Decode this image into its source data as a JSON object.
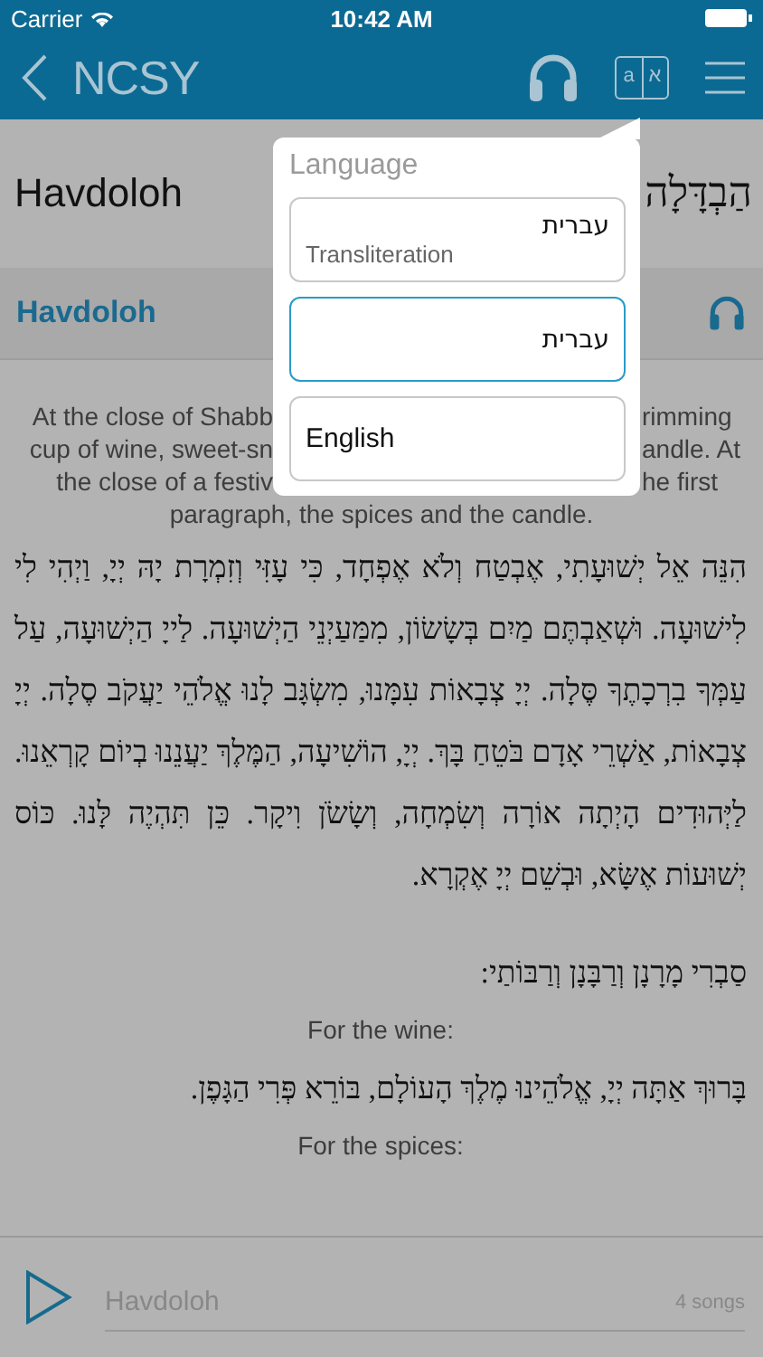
{
  "status_bar": {
    "carrier": "Carrier",
    "time": "10:42 AM"
  },
  "nav": {
    "back_title": "NCSY",
    "language_icon": {
      "latin": "a",
      "hebrew": "א"
    }
  },
  "page_title": {
    "english": "Havdoloh",
    "hebrew": "הַבְדָּלָה"
  },
  "section": {
    "title": "Havdoloh"
  },
  "description_lines": [
    {
      "left": "At the close of Shabb",
      "right": "rimming"
    },
    {
      "left": "cup of wine, sweet-sn",
      "right": "andle. At"
    },
    {
      "left": "the close of a festiv",
      "right": "he first"
    },
    {
      "left": "paragraph, the spices and the candle."
    }
  ],
  "blocks": [
    {
      "kind": "hebrew_paragraph",
      "text": "הִנֵּה אֵל יְשׁוּעָתִי, אֶבְטַח וְלֹא אֶפְחָד, כִּי עָזִּי וְזִמְרָת יָהּ יְיָ, וַיְהִי לִי לִישׁוּעָה. וּשְׁאַבְתֶּם מַיִם בְּשָׂשׂוֹן, מִמַּעַיְנֵי הַיְשׁוּעָה. לַייָ הַיְשׁוּעָה, עַל עַמְּךָ בִרְכָתֶךָ סֶּלָה. יְיָ צְבָאוֹת עִמָּנוּ, מִשְׂגָּב לָנוּ אֱלֹהֵי יַעֲקֹב סֶלָה. יְיָ צְבָאוֹת, אַשְׁרֵי אָדָם בֹּטֵחַ בָּךְ. יְיָ, הוֹשִׁיעָה, הַמֶּלֶךְ יַעֲנֵנוּ בְיוֹם קָרְאֵנוּ. לַיְּהוּדִים הָיְתָה אוֹרָה וְשִׂמְחָה, וְשָׂשֹׂן וִיקָר. כֵּן תִּהְיֶה לָּנוּ. כּוֹס יְשׁוּעוֹת אֶשָּׂא, וּבְשֵׁם יְיָ אֶקְרָא."
    },
    {
      "kind": "hebrew_line",
      "text": "סַבְרִי מָרָנָן וְרַבָּנָן וְרַבּוֹתַי:"
    },
    {
      "kind": "label",
      "text": "For the wine:"
    },
    {
      "kind": "hebrew_line",
      "text": "בָּרוּךְ אַתָּה יְיָ, אֱלֹהֵינוּ מֶלֶךְ הָעוֹלָם, בּוֹרֵא פְּרִי הַגָּפֶן."
    },
    {
      "kind": "label",
      "text": "For the spices:"
    }
  ],
  "player": {
    "title": "Havdoloh",
    "count": "4 songs"
  },
  "language_menu": {
    "title": "Language",
    "options": [
      {
        "primary": "עברית",
        "secondary": "Transliteration",
        "selected": false
      },
      {
        "primary": "עברית",
        "selected": true
      },
      {
        "primary": "English",
        "selected": false
      }
    ]
  }
}
